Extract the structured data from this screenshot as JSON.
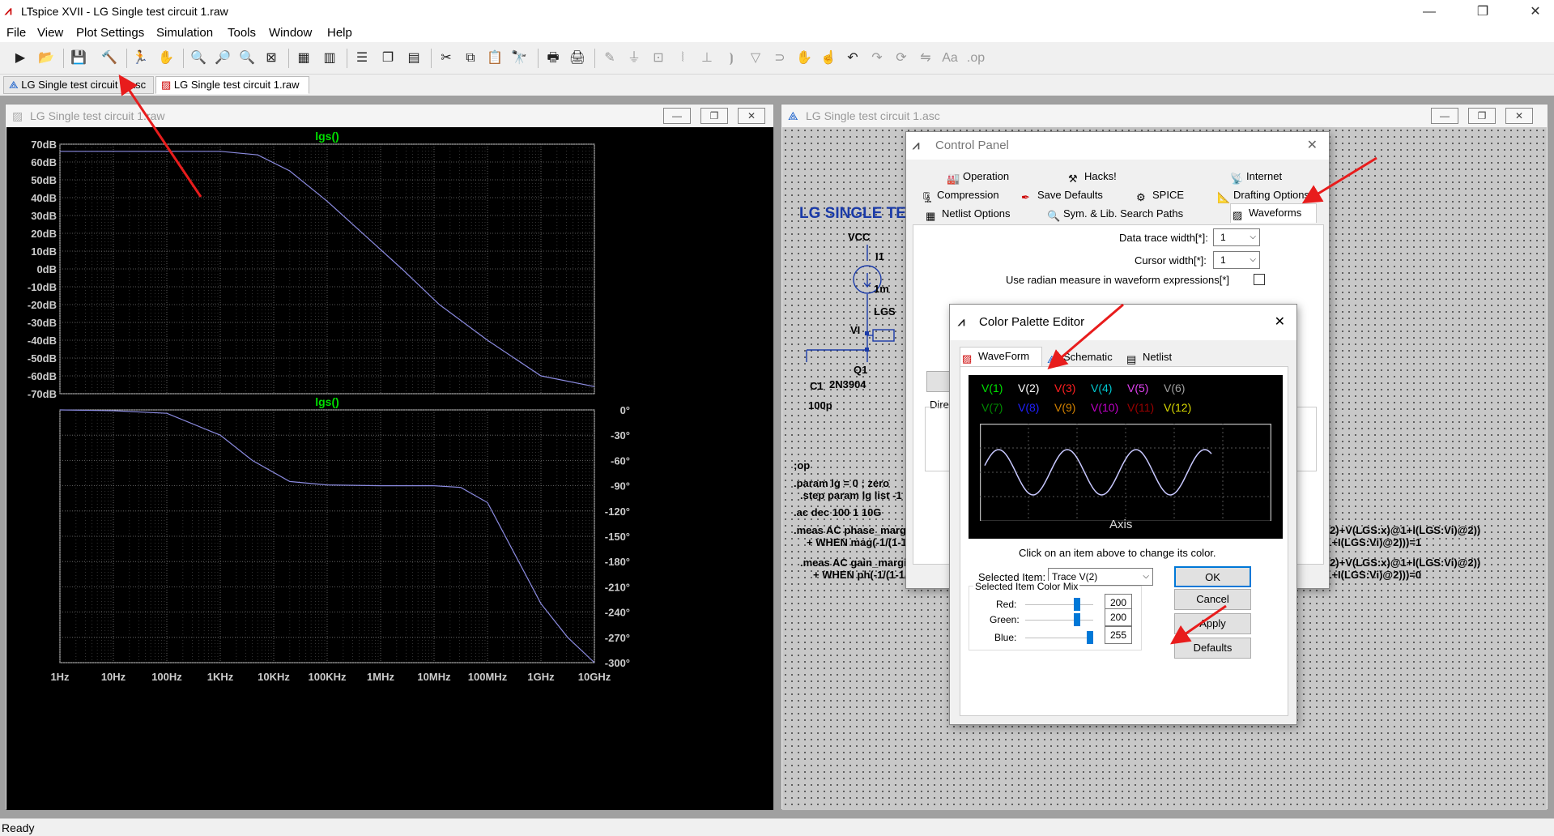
{
  "app": {
    "title": "LTspice XVII - LG Single test circuit 1.raw",
    "minimize": "—",
    "maximize": "❐",
    "close": "✕"
  },
  "menu": [
    "File",
    "View",
    "Plot Settings",
    "Simulation",
    "Tools",
    "Window",
    "Help"
  ],
  "tabs": [
    {
      "label": "LG Single test circuit 1.asc",
      "active": false
    },
    {
      "label": "LG Single test circuit 1.raw",
      "active": true
    }
  ],
  "plot_window": {
    "title": "LG Single test circuit 1.raw"
  },
  "schematic_window": {
    "title": "LG Single test circuit 1.asc"
  },
  "chart_data": [
    {
      "type": "line",
      "title": "lgs()",
      "x": [
        "1Hz",
        "10Hz",
        "100Hz",
        "1KHz",
        "10KHz",
        "100KHz",
        "1MHz",
        "10MHz",
        "100MHz",
        "1GHz",
        "10GHz"
      ],
      "y_ticks": [
        "70dB",
        "60dB",
        "50dB",
        "40dB",
        "30dB",
        "20dB",
        "10dB",
        "0dB",
        "-10dB",
        "-20dB",
        "-30dB",
        "-40dB",
        "-50dB",
        "-60dB",
        "-70dB"
      ],
      "ylim": [
        -70,
        70
      ],
      "series": [
        {
          "values": [
            66,
            66,
            66,
            66,
            64,
            55,
            38,
            19,
            0,
            -20,
            -40,
            -60,
            -66
          ]
        }
      ],
      "x_positions_decade": [
        0,
        1,
        2,
        3,
        3.7,
        4.3,
        5,
        5.7,
        6.4,
        7.1,
        8.0,
        9.0,
        10.0
      ],
      "color": "#8b8be0",
      "grid": true
    },
    {
      "type": "line",
      "title": "lgs()",
      "x": [
        "1Hz",
        "10Hz",
        "100Hz",
        "1KHz",
        "10KHz",
        "100KHz",
        "1MHz",
        "10MHz",
        "100MHz",
        "1GHz",
        "10GHz"
      ],
      "y_ticks": [
        "0°",
        "-30°",
        "-60°",
        "-90°",
        "-120°",
        "-150°",
        "-180°",
        "-210°",
        "-240°",
        "-270°",
        "-300°"
      ],
      "ylim": [
        -300,
        0
      ],
      "series": [
        {
          "values": [
            0,
            -1,
            -4,
            -30,
            -60,
            -85,
            -89,
            -90,
            -90,
            -92,
            -110,
            -170,
            -230,
            -270,
            -300
          ]
        }
      ],
      "x_positions_decade": [
        0,
        1,
        2,
        3,
        3.6,
        4.3,
        5,
        6,
        7,
        7.5,
        8,
        8.5,
        9,
        9.5,
        10
      ],
      "color": "#8b8be0",
      "grid": true
    }
  ],
  "schematic": {
    "heading": "LG SINGLE TE",
    "labels": {
      "vcc": "VCC",
      "i1": "I1",
      "i1_val": "1m",
      "lgs": "LGS",
      "vi": "VI",
      "q1": "Q1",
      "q1_model": "2N3904",
      "c1": "C1",
      "c1_val": "100p"
    },
    "directives": [
      ";op",
      ".param lg = 0 ; zero",
      ".step param lg list -1 1",
      ".ac dec 100 1 10G",
      ".meas AC phase_margin FI",
      "+ WHEN mag(-1/(1-1/(2",
      ".meas AC gain_margin FIN",
      "+ WHEN ph(-1/(1-1/(2*"
    ],
    "right_text": [
      "S:Vi)@2)+V(LGS:x)@1+I(LGS:Vi)@2))",
      "S:x)@1+I(LGS:Vi)@2)))=1",
      "S:Vi)@2)+V(LGS:x)@1+I(LGS:Vi)@2))",
      "S:x)@1+I(LGS:Vi)@2)))=0"
    ]
  },
  "control_panel": {
    "title": "Control Panel",
    "tabs_row1": [
      {
        "label": "Operation",
        "icon": "operation-icon"
      },
      {
        "label": "Hacks!",
        "icon": "hacks-icon"
      },
      {
        "label": "Internet",
        "icon": "internet-icon"
      }
    ],
    "tabs_row2": [
      {
        "label": "Compression",
        "icon": "compression-icon"
      },
      {
        "label": "Save Defaults",
        "icon": "save-defaults-icon"
      },
      {
        "label": "SPICE",
        "icon": "spice-icon"
      },
      {
        "label": "Drafting Options",
        "icon": "drafting-icon"
      }
    ],
    "tabs_row3": [
      {
        "label": "Netlist Options",
        "icon": "netlist-icon"
      },
      {
        "label": "Sym. & Lib. Search Paths",
        "icon": "search-paths-icon"
      },
      {
        "label": "Waveforms",
        "icon": "waveforms-icon"
      }
    ],
    "data_trace_width_label": "Data trace width[*]:",
    "data_trace_width": "1",
    "cursor_width_label": "Cursor width[*]:",
    "cursor_width": "1",
    "radian_label": "Use radian measure in waveform expressions[*]",
    "dir_label": "Dire"
  },
  "palette_editor": {
    "title": "Color Palette Editor",
    "tabs": [
      "WaveForm",
      "Schematic",
      "Netlist"
    ],
    "traces": [
      {
        "label": "V(1)",
        "color": "#00e000"
      },
      {
        "label": "V(2)",
        "color": "#ffffff"
      },
      {
        "label": "V(3)",
        "color": "#ff2020"
      },
      {
        "label": "V(4)",
        "color": "#00c8d0"
      },
      {
        "label": "V(5)",
        "color": "#e040f0"
      },
      {
        "label": "V(6)",
        "color": "#a0a0a0"
      },
      {
        "label": "V(7)",
        "color": "#008a00"
      },
      {
        "label": "V(8)",
        "color": "#2020ff"
      },
      {
        "label": "V(9)",
        "color": "#d08000"
      },
      {
        "label": "V(10)",
        "color": "#c000c8"
      },
      {
        "label": "V(11)",
        "color": "#9a0000"
      },
      {
        "label": "V(12)",
        "color": "#d8d800"
      }
    ],
    "axis_label": "Axis",
    "hint": "Click on an item above to change its color.",
    "selected_item_label": "Selected Item:",
    "selected_item": "Trace  V(2)",
    "color_mix_label": "Selected Item Color Mix",
    "red_label": "Red:",
    "red": "200",
    "green_label": "Green:",
    "green": "200",
    "blue_label": "Blue:",
    "blue": "255",
    "buttons": {
      "ok": "OK",
      "cancel": "Cancel",
      "apply": "Apply",
      "defaults": "Defaults"
    }
  },
  "status": "Ready"
}
